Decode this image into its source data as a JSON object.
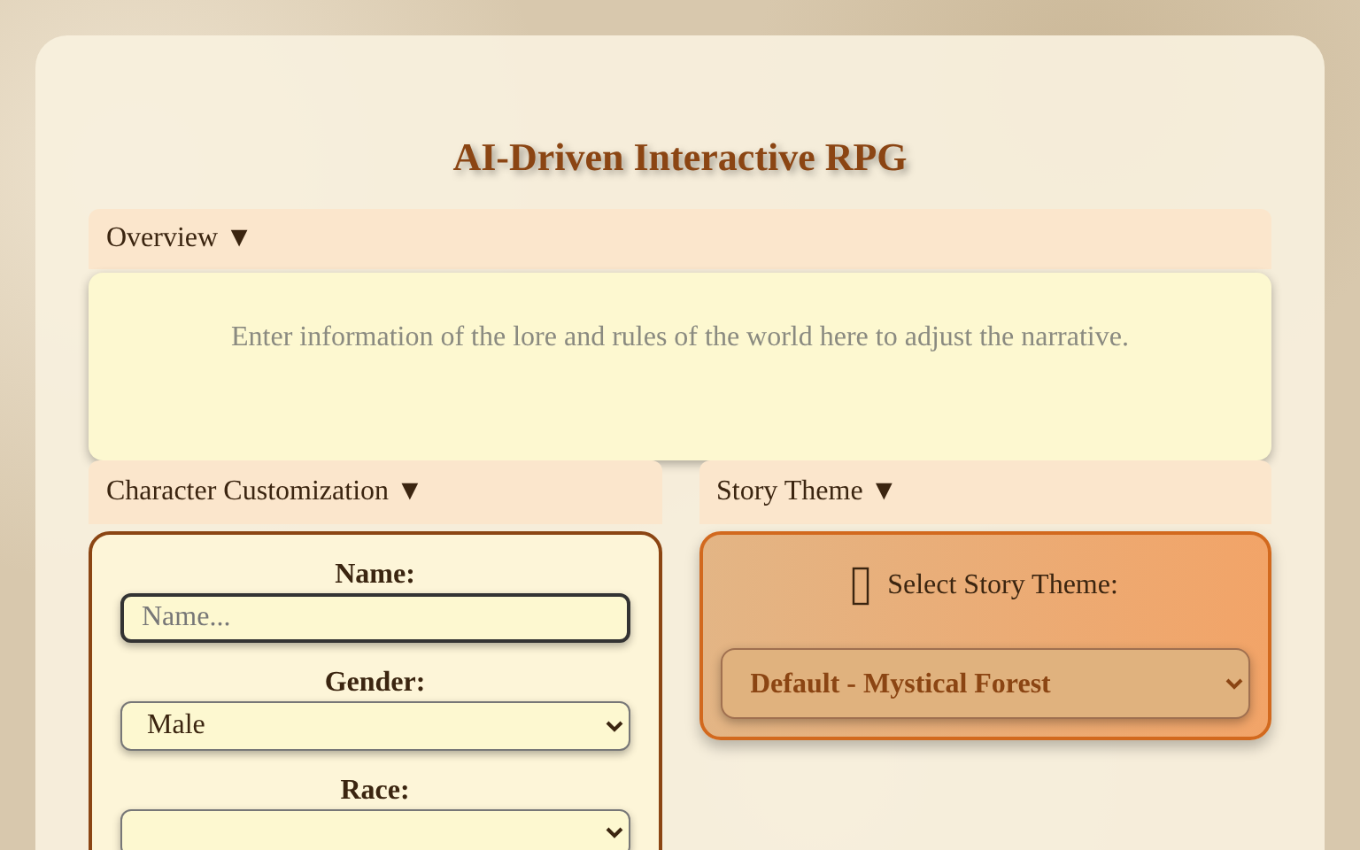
{
  "title": "AI-Driven Interactive RPG",
  "overview": {
    "label": "Overview",
    "toggle": "▼",
    "expanded": true,
    "placeholder": "Enter information of the lore and rules of the world here to adjust the narrative."
  },
  "character": {
    "label": "Character Customization",
    "toggle": "▼",
    "expanded": true,
    "fields": [
      {
        "kind": "input",
        "label": "Name:",
        "placeholder": "Name..."
      },
      {
        "kind": "select",
        "label": "Gender:",
        "value": "Male"
      },
      {
        "kind": "select",
        "label": "Race:"
      }
    ]
  },
  "story_theme": {
    "label": "Story Theme",
    "toggle": "▼",
    "expanded": true,
    "prompt": "Select Story Theme:",
    "value": "Default - Mystical Forest"
  }
}
